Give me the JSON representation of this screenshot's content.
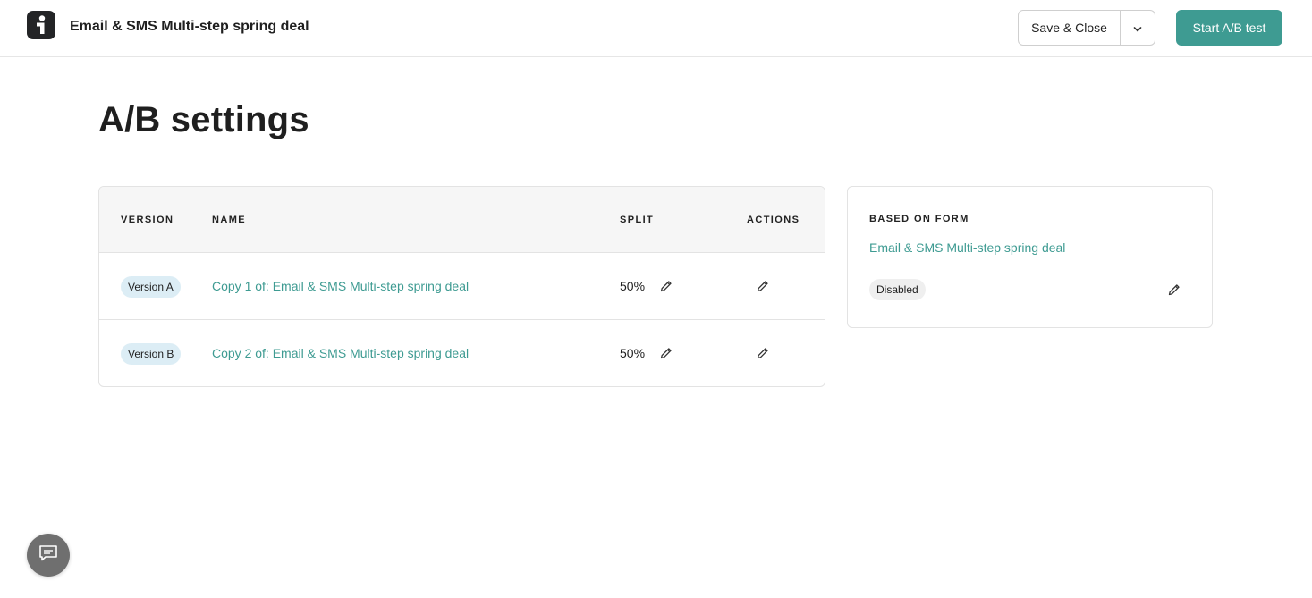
{
  "header": {
    "logo_icon": "brand-logo-icon",
    "title": "Email & SMS Multi-step spring deal",
    "save_label": "Save & Close",
    "dropdown_icon": "chevron-down-icon",
    "start_label": "Start A/B test",
    "accent_color": "#3e9b92"
  },
  "page": {
    "title": "A/B settings"
  },
  "versions_table": {
    "columns": {
      "version": "VERSION",
      "name": "NAME",
      "split": "SPLIT",
      "actions": "ACTIONS"
    },
    "rows": [
      {
        "version": "Version A",
        "name": "Copy 1 of: Email & SMS Multi-step spring deal",
        "split": "50%"
      },
      {
        "version": "Version B",
        "name": "Copy 2 of: Email & SMS Multi-step spring deal",
        "split": "50%"
      }
    ]
  },
  "based_on": {
    "label": "BASED ON FORM",
    "form_name": "Email & SMS Multi-step spring deal",
    "status": "Disabled"
  },
  "chat": {
    "icon": "chat-icon"
  }
}
